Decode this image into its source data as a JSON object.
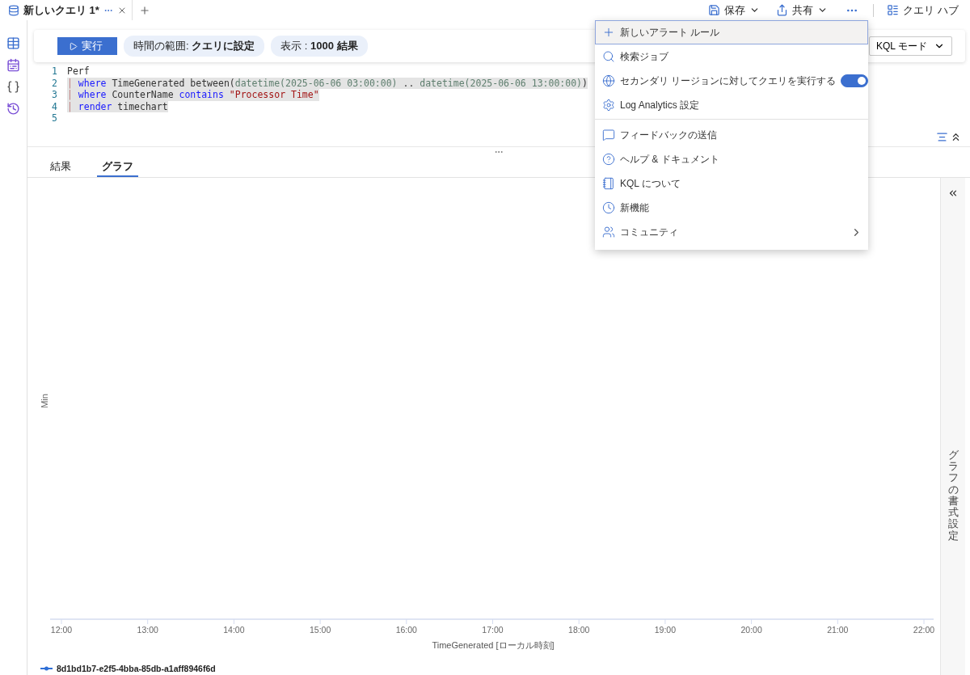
{
  "tab_bar": {
    "tabs": [
      {
        "label": "新しいクエリ 1*",
        "selected": true
      }
    ]
  },
  "top_actions": [
    {
      "label": "保存"
    },
    {
      "label": "共有"
    }
  ],
  "query_hub": {
    "label": "クエリ ハブ"
  },
  "toolbar": {
    "run": "実行",
    "pills": [
      "時間の範囲: **クエリに設定**",
      "表示 : **1000 結果**"
    ],
    "mode": "KQL モード"
  },
  "editor": {
    "lines": [
      {
        "number": "1",
        "highlighted": false,
        "tokens": [
          {
            "kind": "plain",
            "text": "Perf"
          }
        ]
      },
      {
        "number": "2",
        "highlighted": true,
        "tokens": [
          {
            "kind": "pipe",
            "text": "| "
          },
          {
            "kind": "keyword",
            "text": "where"
          },
          {
            "kind": "plain",
            "text": " TimeGenerated between("
          },
          {
            "kind": "func",
            "text": "datetime(2025-06-06 03:00:00)"
          },
          {
            "kind": "plain",
            "text": " .. "
          },
          {
            "kind": "func",
            "text": "datetime(2025-06-06 13:00:00)"
          },
          {
            "kind": "plain",
            "text": ")"
          }
        ]
      },
      {
        "number": "3",
        "highlighted": true,
        "tokens": [
          {
            "kind": "pipe",
            "text": "| "
          },
          {
            "kind": "keyword",
            "text": "where"
          },
          {
            "kind": "plain",
            "text": " CounterName "
          },
          {
            "kind": "keyword",
            "text": "contains"
          },
          {
            "kind": "string",
            "text": " \"Processor Time\""
          }
        ]
      },
      {
        "number": "4",
        "highlighted": true,
        "tokens": [
          {
            "kind": "pipe",
            "text": "| "
          },
          {
            "kind": "keyword",
            "text": "render"
          },
          {
            "kind": "plain",
            "text": " timechart"
          }
        ]
      },
      {
        "number": "5",
        "highlighted": false
      }
    ]
  },
  "result_tabs": [
    {
      "label": "結果",
      "selected": false
    },
    {
      "label": "グラフ",
      "selected": true
    }
  ],
  "chart": {
    "xlabel": "TimeGenerated [ローカル時刻]",
    "ylabel": "Min",
    "xticks": [
      "12:00",
      "13:00",
      "14:00",
      "15:00",
      "16:00",
      "17:00",
      "18:00",
      "19:00",
      "20:00",
      "21:00",
      "22:00"
    ],
    "legend": [
      {
        "name": "8d1bd1b7-e2f5-4bba-85db-a1aff8946f6d",
        "color": "#2f6fd6"
      }
    ]
  },
  "side_panel": {
    "title": "グラフの書式設定"
  },
  "menu": {
    "sections": [
      [
        {
          "kind": "item",
          "label": "新しいアラート ルール",
          "highlighted": true
        },
        {
          "kind": "item",
          "label": "検索ジョブ",
          "highlighted": false
        },
        {
          "kind": "toggle",
          "label": "セカンダリ リージョンに対してクエリを実行する",
          "highlighted": false,
          "on": true
        },
        {
          "kind": "item",
          "label": "Log Analytics 設定",
          "highlighted": false
        }
      ],
      [
        {
          "kind": "item",
          "label": "フィードバックの送信",
          "highlighted": false
        },
        {
          "kind": "item",
          "label": "ヘルプ & ドキュメント",
          "highlighted": false
        },
        {
          "kind": "item",
          "label": "KQL について",
          "highlighted": false
        },
        {
          "kind": "item",
          "label": "新機能",
          "highlighted": false
        },
        {
          "kind": "submenu",
          "label": "コミュニティ",
          "highlighted": false
        }
      ]
    ]
  }
}
